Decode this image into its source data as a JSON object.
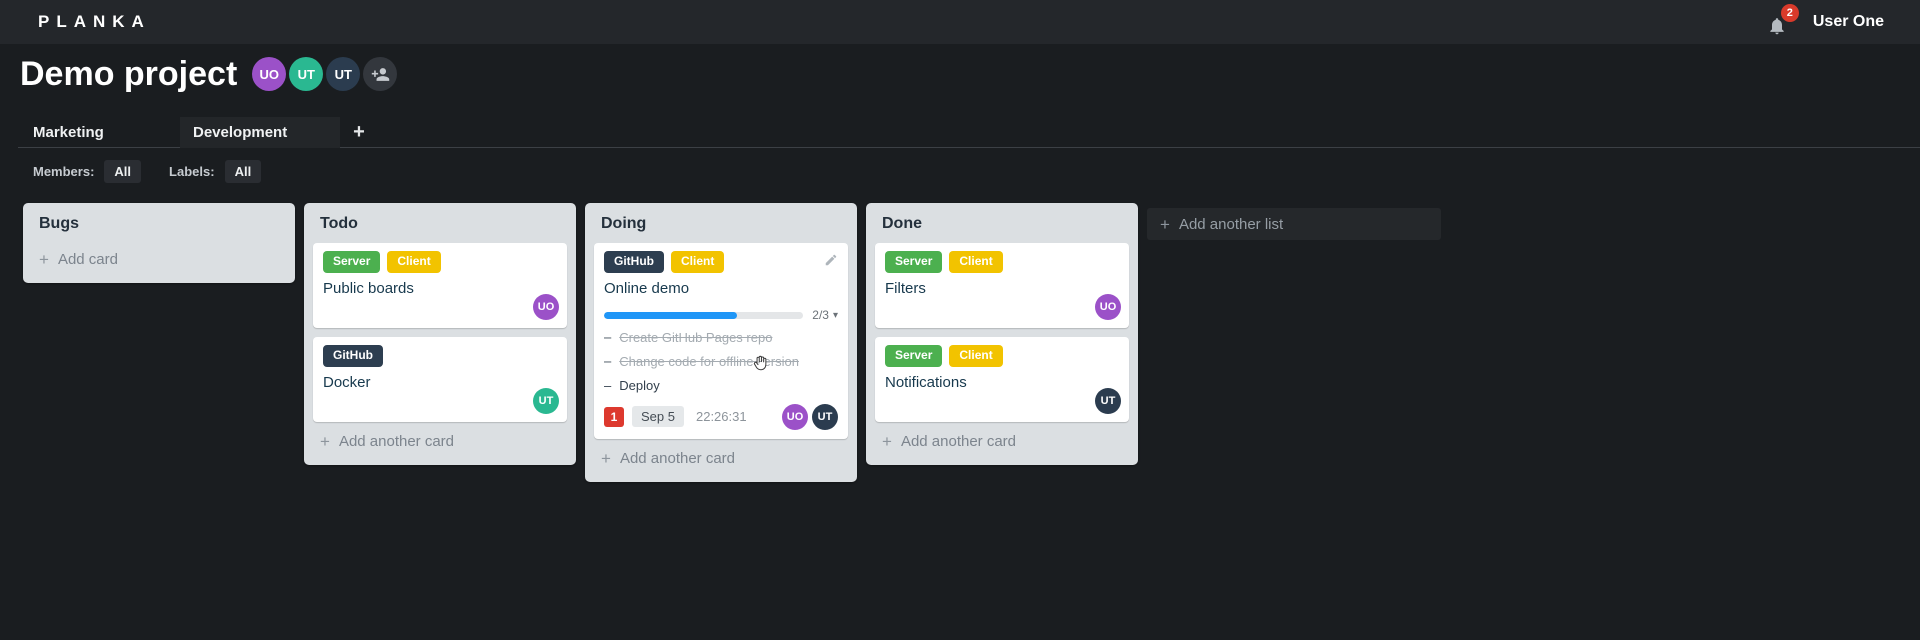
{
  "topbar": {
    "logo": "PLANKA",
    "notification_count": "2",
    "user_name": "User One"
  },
  "project": {
    "title": "Demo project",
    "members": [
      {
        "initials": "UO",
        "color": "#9b51c8"
      },
      {
        "initials": "UT",
        "color": "#2ab891"
      },
      {
        "initials": "UT",
        "color": "#2b3c4f"
      }
    ]
  },
  "tabs": {
    "items": [
      {
        "label": "Marketing"
      },
      {
        "label": "Development"
      }
    ],
    "active": "Development"
  },
  "filters": {
    "members_label": "Members:",
    "members_value": "All",
    "labels_label": "Labels:",
    "labels_value": "All"
  },
  "colors": {
    "danger": "#dd392e",
    "progress": "#1f96f7"
  },
  "board": {
    "add_list_label": "Add another list",
    "lists": [
      {
        "title": "Bugs",
        "add_label": "Add card",
        "cards": []
      },
      {
        "title": "Todo",
        "add_label": "Add another card",
        "cards": [
          {
            "title": "Public boards",
            "labels": [
              {
                "text": "Server",
                "color": "#4cb04f"
              },
              {
                "text": "Client",
                "color": "#f2c300"
              }
            ],
            "members": [
              {
                "initials": "UO",
                "color": "#9b51c8"
              }
            ]
          },
          {
            "title": "Docker",
            "labels": [
              {
                "text": "GitHub",
                "color": "#2d3e50"
              }
            ],
            "members": [
              {
                "initials": "UT",
                "color": "#2ab891"
              }
            ]
          }
        ]
      },
      {
        "title": "Doing",
        "add_label": "Add another card",
        "cards": [
          {
            "title": "Online demo",
            "labels": [
              {
                "text": "GitHub",
                "color": "#2d3e50"
              },
              {
                "text": "Client",
                "color": "#f2c300"
              }
            ],
            "progress": {
              "label": "2/3",
              "percent": "66.7"
            },
            "tasks": [
              {
                "text": "Create GitHub Pages repo",
                "done": true
              },
              {
                "text": "Change code for offline version",
                "done": true
              },
              {
                "text": "Deploy",
                "done": false
              }
            ],
            "notification_count": "1",
            "due_date": "Sep 5",
            "timer": "22:26:31",
            "members": [
              {
                "initials": "UO",
                "color": "#9b51c8"
              },
              {
                "initials": "UT",
                "color": "#2b3c4f"
              }
            ]
          }
        ]
      },
      {
        "title": "Done",
        "add_label": "Add another card",
        "cards": [
          {
            "title": "Filters",
            "labels": [
              {
                "text": "Server",
                "color": "#4cb04f"
              },
              {
                "text": "Client",
                "color": "#f2c300"
              }
            ],
            "members": [
              {
                "initials": "UO",
                "color": "#9b51c8"
              }
            ]
          },
          {
            "title": "Notifications",
            "labels": [
              {
                "text": "Server",
                "color": "#4cb04f"
              },
              {
                "text": "Client",
                "color": "#f2c300"
              }
            ],
            "members": [
              {
                "initials": "UT",
                "color": "#2b3c4f"
              }
            ]
          }
        ]
      }
    ]
  }
}
